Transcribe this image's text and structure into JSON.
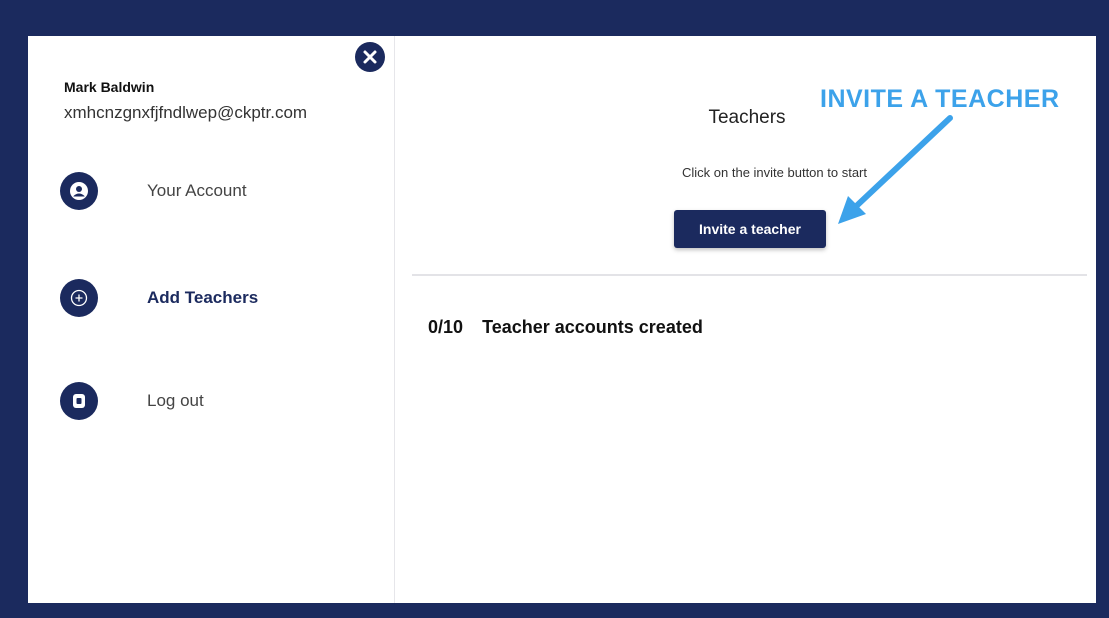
{
  "sidebar": {
    "user_name": "Mark Baldwin",
    "user_email": "xmhcnzgnxfjfndlwep@ckptr.com",
    "items": [
      {
        "label": "Your Account",
        "icon": "user-icon",
        "active": false
      },
      {
        "label": "Add Teachers",
        "icon": "plus-circle-icon",
        "active": true
      },
      {
        "label": "Log out",
        "icon": "logout-icon",
        "active": false
      }
    ],
    "close_icon": "close-icon"
  },
  "main": {
    "title": "Teachers",
    "subtitle": "Click on the invite button to start",
    "invite_button_label": "Invite a teacher",
    "count": "0/10",
    "count_label": "Teacher accounts created"
  },
  "annotation": {
    "text": "INVITE A TEACHER",
    "color": "#3ca2ea"
  },
  "colors": {
    "navy": "#1b2a5e",
    "annotation": "#3ca2ea"
  }
}
